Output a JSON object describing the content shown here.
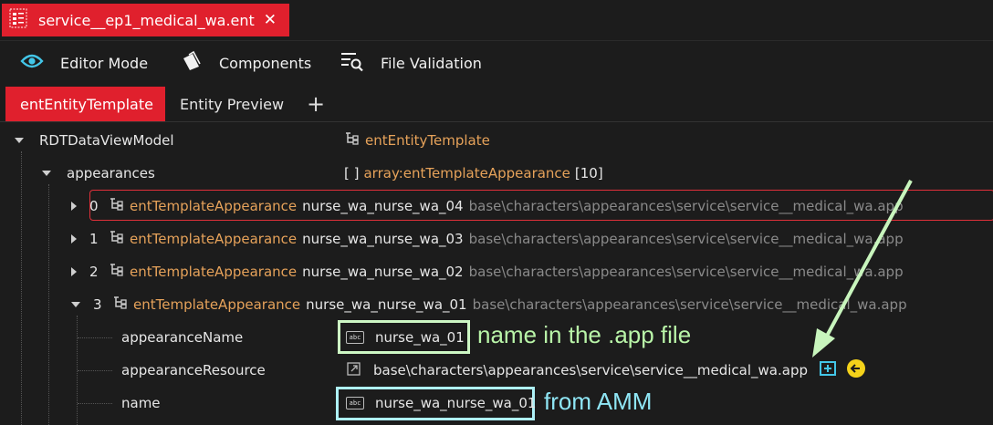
{
  "file_tab": {
    "label": "service__ep1_medical_wa.ent",
    "close": "✕"
  },
  "toolbar": {
    "editor_mode": "Editor Mode",
    "components": "Components",
    "file_validation": "File Validation"
  },
  "doc_tabs": {
    "template": "entEntityTemplate",
    "preview": "Entity Preview",
    "add": "+"
  },
  "tree": {
    "root": {
      "name": "RDTDataViewModel",
      "type": "entEntityTemplate"
    },
    "appearances": {
      "name": "appearances",
      "brackets": "[ ]",
      "type": "array:entTemplateAppearance",
      "count": "[10]"
    },
    "items": [
      {
        "index": "0",
        "type": "entTemplateAppearance",
        "name": "nurse_wa_nurse_wa_04",
        "path": "base\\characters\\appearances\\service\\service__medical_wa.app"
      },
      {
        "index": "1",
        "type": "entTemplateAppearance",
        "name": "nurse_wa_nurse_wa_03",
        "path": "base\\characters\\appearances\\service\\service__medical_wa.app"
      },
      {
        "index": "2",
        "type": "entTemplateAppearance",
        "name": "nurse_wa_nurse_wa_02",
        "path": "base\\characters\\appearances\\service\\service__medical_wa.app"
      },
      {
        "index": "3",
        "type": "entTemplateAppearance",
        "name": "nurse_wa_nurse_wa_01",
        "path": "base\\characters\\appearances\\service\\service__medical_wa.app"
      }
    ],
    "fields": {
      "appearanceName": {
        "label": "appearanceName",
        "value": "nurse_wa_01"
      },
      "appearanceResource": {
        "label": "appearanceResource",
        "value": "base\\characters\\appearances\\service\\service__medical_wa.app"
      },
      "name": {
        "label": "name",
        "value": "nurse_wa_nurse_wa_01"
      }
    }
  },
  "annotations": {
    "app_file_note": "name in the .app file",
    "amm_note": "from AMM"
  },
  "colors": {
    "accent_red": "#e0202d",
    "type_orange": "#e6a25a",
    "note_green": "#b9f5a8",
    "note_cyan": "#8fe6f5"
  }
}
